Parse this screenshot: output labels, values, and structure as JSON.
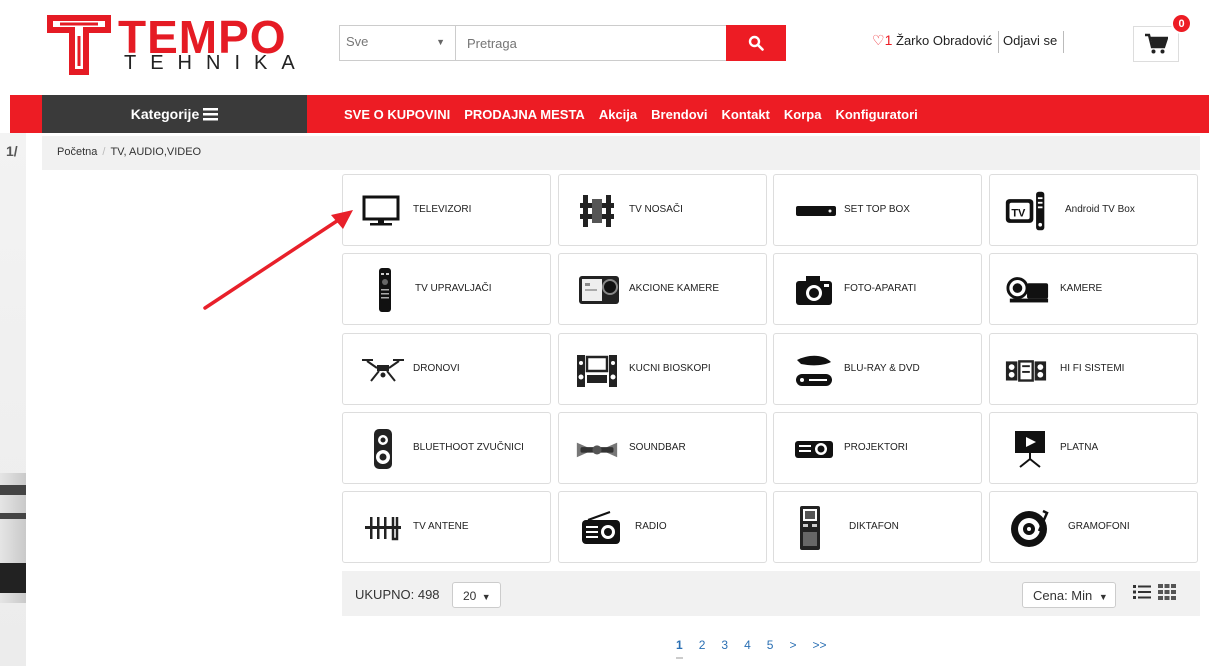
{
  "header": {
    "logo_top": "TEMPO",
    "logo_bottom": "TEHNIKA",
    "search_category": "Sve",
    "search_placeholder": "Pretraga",
    "wishlist_count": "1",
    "user_name": "Žarko Obradović",
    "logout_label": "Odjavi se",
    "cart_count": "0"
  },
  "nav": {
    "categories_label": "Kategorije",
    "links": [
      "SVE O KUPOVINI",
      "PRODAJNA MESTA",
      "Akcija",
      "Brendovi",
      "Kontakt",
      "Korpa",
      "Konfiguratori"
    ]
  },
  "breadcrumb": {
    "home": "Početna",
    "current": "TV, AUDIO,VIDEO"
  },
  "side_number": "1/",
  "tiles": [
    {
      "label": "TELEVIZORI",
      "icon": "tv-icon"
    },
    {
      "label": "TV NOSAČI",
      "icon": "tv-mount-icon"
    },
    {
      "label": "SET TOP BOX",
      "icon": "set-top-box-icon"
    },
    {
      "label": "Android TV Box",
      "icon": "android-tv-box-icon"
    },
    {
      "label": "TV UPRAVLJAČI",
      "icon": "remote-control-icon"
    },
    {
      "label": "AKCIONE KAMERE",
      "icon": "action-camera-icon"
    },
    {
      "label": "FOTO-APARATI",
      "icon": "photo-camera-icon"
    },
    {
      "label": "KAMERE",
      "icon": "video-camera-icon"
    },
    {
      "label": "DRONOVI",
      "icon": "drone-icon"
    },
    {
      "label": "KUCNI BIOSKOPI",
      "icon": "home-theater-icon"
    },
    {
      "label": "BLU-RAY & DVD",
      "icon": "bluray-icon"
    },
    {
      "label": "HI FI SISTEMI",
      "icon": "hifi-icon"
    },
    {
      "label": "BLUETHOOT ZVUČNICI",
      "icon": "bluetooth-speaker-icon"
    },
    {
      "label": "SOUNDBAR",
      "icon": "soundbar-icon"
    },
    {
      "label": "PROJEKTORI",
      "icon": "projector-icon"
    },
    {
      "label": "PLATNA",
      "icon": "projector-screen-icon"
    },
    {
      "label": "TV ANTENE",
      "icon": "antenna-icon"
    },
    {
      "label": "RADIO",
      "icon": "radio-icon"
    },
    {
      "label": "DIKTAFON",
      "icon": "dictaphone-icon"
    },
    {
      "label": "GRAMOFONI",
      "icon": "turntable-icon"
    }
  ],
  "listing": {
    "total": "UKUPNO: 498",
    "per_page": "20",
    "sort": "Cena: Min"
  },
  "pagination": [
    "1",
    "2",
    "3",
    "4",
    "5",
    ">",
    ">>"
  ],
  "colors": {
    "brand_red": "#ed1c24",
    "dark": "#3a3a3a",
    "link_blue": "#2a6fb3"
  }
}
